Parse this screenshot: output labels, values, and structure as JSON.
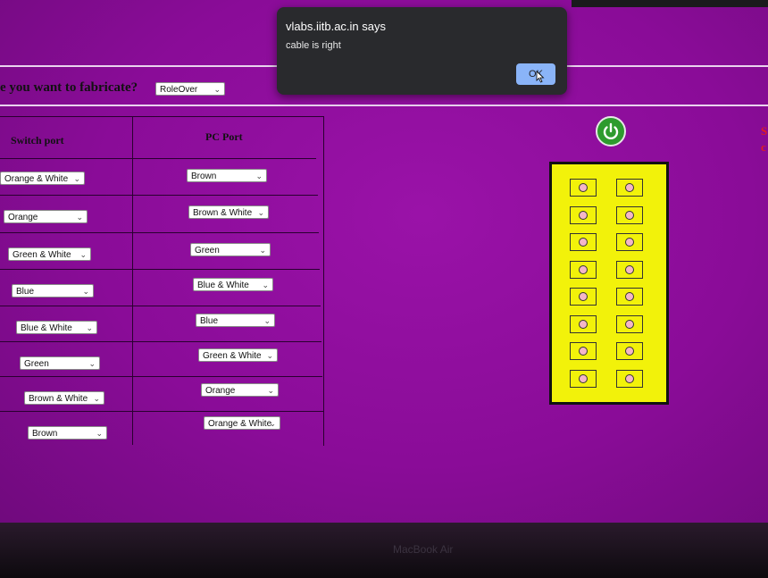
{
  "question": {
    "text": "e you want to fabricate?",
    "selected": "RoleOver"
  },
  "table": {
    "headers": [
      "Switch port",
      "PC Port"
    ],
    "switch_ports": [
      "Orange & White",
      "Orange",
      "Green & White",
      "Blue",
      "Blue & White",
      "Green",
      "Brown & White",
      "Brown"
    ],
    "pc_ports": [
      "Brown",
      "Brown & White",
      "Green",
      "Blue & White",
      "Blue",
      "Green & White",
      "Orange",
      "Orange & White"
    ]
  },
  "dialog": {
    "title": "vlabs.iitb.ac.in says",
    "message": "cable is right",
    "ok_label": "OK"
  },
  "panel": {
    "rows": 8,
    "columns": 2
  },
  "colors": {
    "background": "#8a0c98",
    "panel": "#f2f20a",
    "power": "#2e9b2e",
    "port_dot": "#f4b6c8",
    "ok_button": "#8ab4f8"
  },
  "bezel": {
    "label": "MacBook Air"
  }
}
